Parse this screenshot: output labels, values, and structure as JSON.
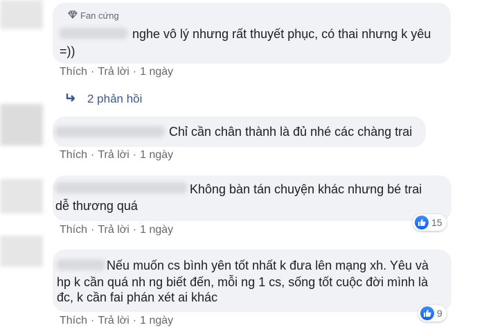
{
  "comments": [
    {
      "badge": "Fan cứng",
      "text_line1": "nghe vô lý nhưng rất thuyết phục, có thai nhưng k yêu",
      "text_line2": "=))",
      "actions": {
        "like": "Thích",
        "reply": "Trả lời",
        "time": "1 ngày"
      }
    },
    {
      "text_line1": "Chỉ cần chân thành là đủ nhé các chàng trai",
      "actions": {
        "like": "Thích",
        "reply": "Trả lời",
        "time": "1 ngày"
      }
    },
    {
      "text_line1": "Không bàn tán chuyện khác nhưng bé trai",
      "text_line2": "dễ thương quá",
      "actions": {
        "like": "Thích",
        "reply": "Trả lời",
        "time": "1 ngày"
      },
      "reactions": "15"
    },
    {
      "text_line1": "Nếu muốn cs bình yên tốt nhất k đưa lên mạng xh. Yêu và",
      "text_line2": "hp k cần quá nh ng biết đến, mỗi ng 1 cs, sống tốt cuộc đời mình là",
      "text_line3": "đc, k cần fai phán xét ai khác",
      "actions": {
        "like": "Thích",
        "reply": "Trả lời",
        "time": "1 ngày"
      },
      "reactions": "9"
    }
  ],
  "replies_link": "2 phản hồi",
  "separator": "·",
  "colors": {
    "bubble": "#f0f2f5",
    "link": "#385898",
    "meta": "#65676b",
    "like": "#1877f2"
  },
  "icons": [
    "diamond-icon",
    "reply-arrow-icon",
    "like-thumb-icon"
  ]
}
